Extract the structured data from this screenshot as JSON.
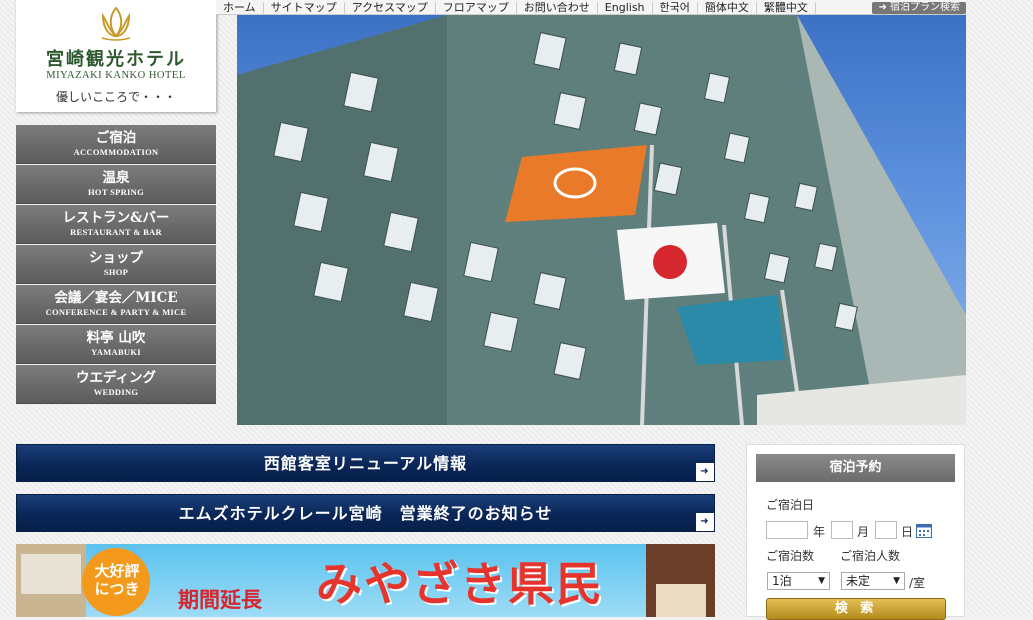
{
  "logo": {
    "name_jp": "宮崎観光ホテル",
    "name_en": "MIYAZAKI KANKO HOTEL",
    "tagline": "優しいこころで・・・"
  },
  "top_nav": {
    "items": [
      "ホーム",
      "サイトマップ",
      "アクセスマップ",
      "フロアマップ",
      "お問い合わせ",
      "English",
      "한국어",
      "簡体中文",
      "繁體中文"
    ],
    "plan_search": "宿泊プラン検索"
  },
  "side_nav": [
    {
      "jp": "ご宿泊",
      "en": "ACCOMMODATION"
    },
    {
      "jp": "温泉",
      "en": "HOT SPRING"
    },
    {
      "jp": "レストラン&バー",
      "en": "RESTAURANT & BAR"
    },
    {
      "jp": "ショップ",
      "en": "SHOP"
    },
    {
      "jp": "会議／宴会／MICE",
      "en": "CONFERENCE & PARTY & MICE"
    },
    {
      "jp": "料亭 山吹",
      "en": "YAMABUKI"
    },
    {
      "jp": "ウエディング",
      "en": "WEDDING"
    }
  ],
  "announcements": [
    "西館客室リニューアル情報",
    "エムズホテルクレール宮崎　営業終了のお知らせ"
  ],
  "banner": {
    "badge": "大好評につき",
    "sub": "期間延長",
    "main": "みやざき県民"
  },
  "reservation": {
    "title": "宿泊予約",
    "checkin_label": "ご宿泊日",
    "year_unit": "年",
    "month_unit": "月",
    "day_unit": "日",
    "nights_label": "ご宿泊数",
    "guests_label": "ご宿泊人数",
    "nights_value": "1泊",
    "guests_value": "未定",
    "per_room": "/室",
    "search_button": "検 索"
  },
  "colors": {
    "nav_gray": "#6b6b6b",
    "bar_navy": "#0a2657",
    "logo_green": "#2f5a2f",
    "gold": "#c9a13a"
  }
}
